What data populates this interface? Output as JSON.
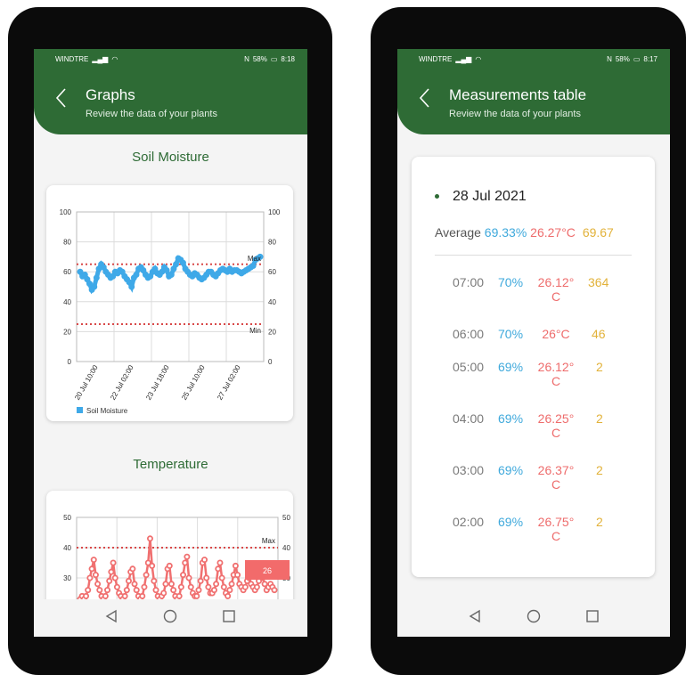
{
  "left": {
    "status": {
      "carrier": "WINDTRE",
      "nfc": "N",
      "battery": "58%",
      "time": "8:18"
    },
    "header": {
      "title": "Graphs",
      "subtitle": "Review the data of your plants"
    },
    "soil": {
      "title": "Soil Moisture",
      "legend": "Soil Moisture",
      "max_label": "Max",
      "min_label": "Min"
    },
    "temp": {
      "title": "Temperature",
      "max_label": "Max",
      "tooltip": "26"
    }
  },
  "right": {
    "status": {
      "carrier": "WINDTRE",
      "nfc": "N",
      "battery": "58%",
      "time": "8:17"
    },
    "header": {
      "title": "Measurements table",
      "subtitle": "Review the data of your plants"
    },
    "date": "28 Jul 2021",
    "average": {
      "label": "Average",
      "moisture": "69.33%",
      "temperature": "26.27°C",
      "light": "69.67"
    },
    "rows": [
      {
        "time": "07:00",
        "moisture": "70%",
        "temp_a": "26.12°",
        "temp_b": "C",
        "light": "364"
      },
      {
        "time": "06:00",
        "moisture": "70%",
        "temp_a": "26°C",
        "temp_b": "",
        "light": "46"
      },
      {
        "time": "05:00",
        "moisture": "69%",
        "temp_a": "26.12°",
        "temp_b": "C",
        "light": "2"
      },
      {
        "time": "04:00",
        "moisture": "69%",
        "temp_a": "26.25°",
        "temp_b": "C",
        "light": "2"
      },
      {
        "time": "03:00",
        "moisture": "69%",
        "temp_a": "26.37°",
        "temp_b": "C",
        "light": "2"
      },
      {
        "time": "02:00",
        "moisture": "69%",
        "temp_a": "26.75°",
        "temp_b": "C",
        "light": "2"
      }
    ]
  },
  "chart_data": [
    {
      "type": "scatter",
      "title": "Soil Moisture",
      "series": [
        {
          "name": "Soil Moisture",
          "values": [
            60,
            57,
            58,
            55,
            52,
            48,
            50,
            56,
            62,
            65,
            63,
            60,
            58,
            56,
            57,
            60,
            59,
            61,
            60,
            57,
            55,
            53,
            50,
            56,
            58,
            62,
            63,
            61,
            58,
            56,
            57,
            60,
            62,
            59,
            58,
            60,
            63,
            61,
            57,
            58,
            62,
            65,
            69,
            68,
            66,
            62,
            60,
            58,
            57,
            59,
            58,
            56,
            55,
            56,
            58,
            60,
            60,
            58,
            57,
            59,
            61,
            62,
            61,
            60,
            62,
            60,
            61,
            61,
            60,
            59,
            60,
            61,
            62,
            63,
            64,
            68,
            69,
            70
          ]
        }
      ],
      "xticks": [
        "20 Jul 10:00",
        "22 Jul 02:00",
        "23 Jul 18:00",
        "25 Jul 10:00",
        "27 Jul 02:00"
      ],
      "ylim": [
        0,
        100
      ],
      "yticks": [
        0,
        20,
        40,
        60,
        80,
        100
      ],
      "max_line": 65,
      "min_line": 25,
      "color": "#3fa9e8"
    },
    {
      "type": "scatter",
      "title": "Temperature",
      "series": [
        {
          "name": "Temperature",
          "values": [
            23,
            24,
            23,
            24,
            26,
            30,
            33,
            36,
            31,
            28,
            26,
            24,
            23,
            24,
            26,
            29,
            32,
            35,
            30,
            27,
            25,
            24,
            23,
            24,
            26,
            29,
            32,
            33,
            28,
            26,
            24,
            23,
            24,
            27,
            31,
            35,
            43,
            34,
            29,
            26,
            24,
            23,
            24,
            25,
            28,
            33,
            34,
            28,
            26,
            24,
            23,
            24,
            27,
            31,
            35,
            37,
            30,
            27,
            25,
            24,
            24,
            26,
            29,
            35,
            36,
            30,
            27,
            25,
            25,
            26,
            28,
            33,
            35,
            30,
            27,
            25,
            24,
            26,
            28,
            31,
            34,
            31,
            28,
            27,
            26,
            27,
            29,
            30,
            28,
            27,
            26,
            27,
            29,
            31,
            30,
            28,
            26,
            27,
            28,
            27,
            26
          ]
        }
      ],
      "ylim": [
        20,
        50
      ],
      "yticks": [
        30,
        40,
        50
      ],
      "max_line": 40,
      "color": "#f07070"
    }
  ],
  "colors": {
    "header_green": "#2e6b35",
    "moisture": "#3fa9dc",
    "temperature": "#ee6c6c",
    "light": "#e2b23a"
  }
}
